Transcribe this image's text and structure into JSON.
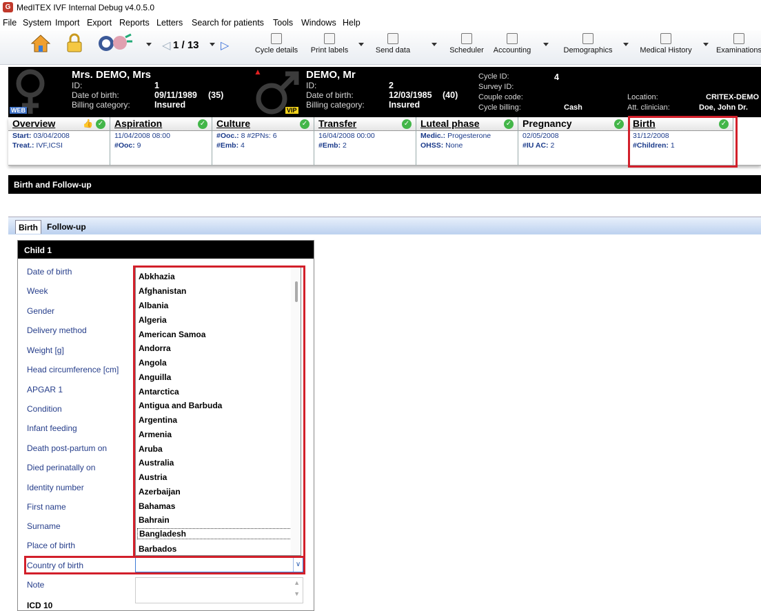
{
  "window": {
    "title": "MedITEX IVF Internal Debug v4.0.5.0"
  },
  "menu": [
    "File",
    "System",
    "Import",
    "Export",
    "Reports",
    "Letters",
    "Search for patients",
    "Tools",
    "Windows",
    "Help"
  ],
  "toolbar": {
    "counter": "1 / 13",
    "buttons": [
      "Cycle details",
      "Print labels",
      "Send data",
      "Scheduler",
      "Accounting",
      "Demographics",
      "Medical History",
      "Examinations"
    ]
  },
  "patient": {
    "female_name": "Mrs. DEMO, Mrs",
    "female_id_label": "ID:",
    "female_id": "1",
    "female_dob_label": "Date of birth:",
    "female_dob": "09/11/1989",
    "female_age": "(35)",
    "female_billing_label": "Billing category:",
    "female_billing": "Insured",
    "web_badge": "WEB",
    "male_name": "DEMO, Mr",
    "male_id_label": "ID:",
    "male_id": "2",
    "male_dob_label": "Date of birth:",
    "male_dob": "12/03/1985",
    "male_age": "(40)",
    "male_billing_label": "Billing category:",
    "male_billing": "Insured",
    "vip_badge": "VIP",
    "cycle_id_label": "Cycle ID:",
    "cycle_id": "4",
    "survey_id_label": "Survey ID:",
    "couple_code_label": "Couple code:",
    "cycle_billing_label": "Cycle billing:",
    "cycle_billing": "Cash",
    "location_label": "Location:",
    "location": "CRITEX-DEMO",
    "clinician_label": "Att. clinician:",
    "clinician": "Doe, John Dr."
  },
  "phases": [
    {
      "title": "Overview",
      "l1a": "Start:",
      "l1b": " 03/04/2008",
      "l2a": "Treat.:",
      "l2b": " IVF,ICSI"
    },
    {
      "title": "Aspiration",
      "l1a": "",
      "l1b": "11/04/2008 08:00",
      "l2a": "#Ooc:",
      "l2b": " 9"
    },
    {
      "title": "Culture",
      "l1a": "#Ooc.:",
      "l1b": " 8 #2PNs: 6",
      "l2a": "#Emb:",
      "l2b": " 4"
    },
    {
      "title": "Transfer",
      "l1a": "",
      "l1b": "16/04/2008 00:00",
      "l2a": "#Emb:",
      "l2b": " 2"
    },
    {
      "title": "Luteal phase",
      "l1a": "Medic.:",
      "l1b": " Progesterone",
      "l2a": "OHSS:",
      "l2b": " None"
    },
    {
      "title": "Pregnancy",
      "l1a": "",
      "l1b": "02/05/2008",
      "l2a": "#IU AC:",
      "l2b": " 2"
    },
    {
      "title": "Birth",
      "l1a": "",
      "l1b": "31/12/2008",
      "l2a": "#Children:",
      "l2b": " 1"
    }
  ],
  "section_title": "Birth and Follow-up",
  "subtabs": [
    "Birth",
    "Follow-up"
  ],
  "child_panel_title": "Child 1",
  "fields": [
    "Date of birth",
    "Week",
    "Gender",
    "Delivery method",
    "Weight [g]",
    "Head circumference [cm]",
    "APGAR 1",
    "Condition",
    "Infant feeding",
    "Death post-partum on",
    "Died perinatally on",
    "Identity number",
    "First name",
    "Surname",
    "Place of birth",
    "Country of birth",
    "Note",
    "ICD 10"
  ],
  "country_list": [
    "Abkhazia",
    "Afghanistan",
    "Albania",
    "Algeria",
    "American Samoa",
    "Andorra",
    "Angola",
    "Anguilla",
    "Antarctica",
    "Antigua and Barbuda",
    "Argentina",
    "Armenia",
    "Aruba",
    "Australia",
    "Austria",
    "Azerbaijan",
    "Bahamas",
    "Bahrain",
    "Bangladesh",
    "Barbados"
  ],
  "country_selected": "Bangladesh",
  "colors": {
    "highlight": "#d21f2a",
    "header_bg": "#000000",
    "link_blue": "#253d8a",
    "check_green": "#43b649"
  }
}
